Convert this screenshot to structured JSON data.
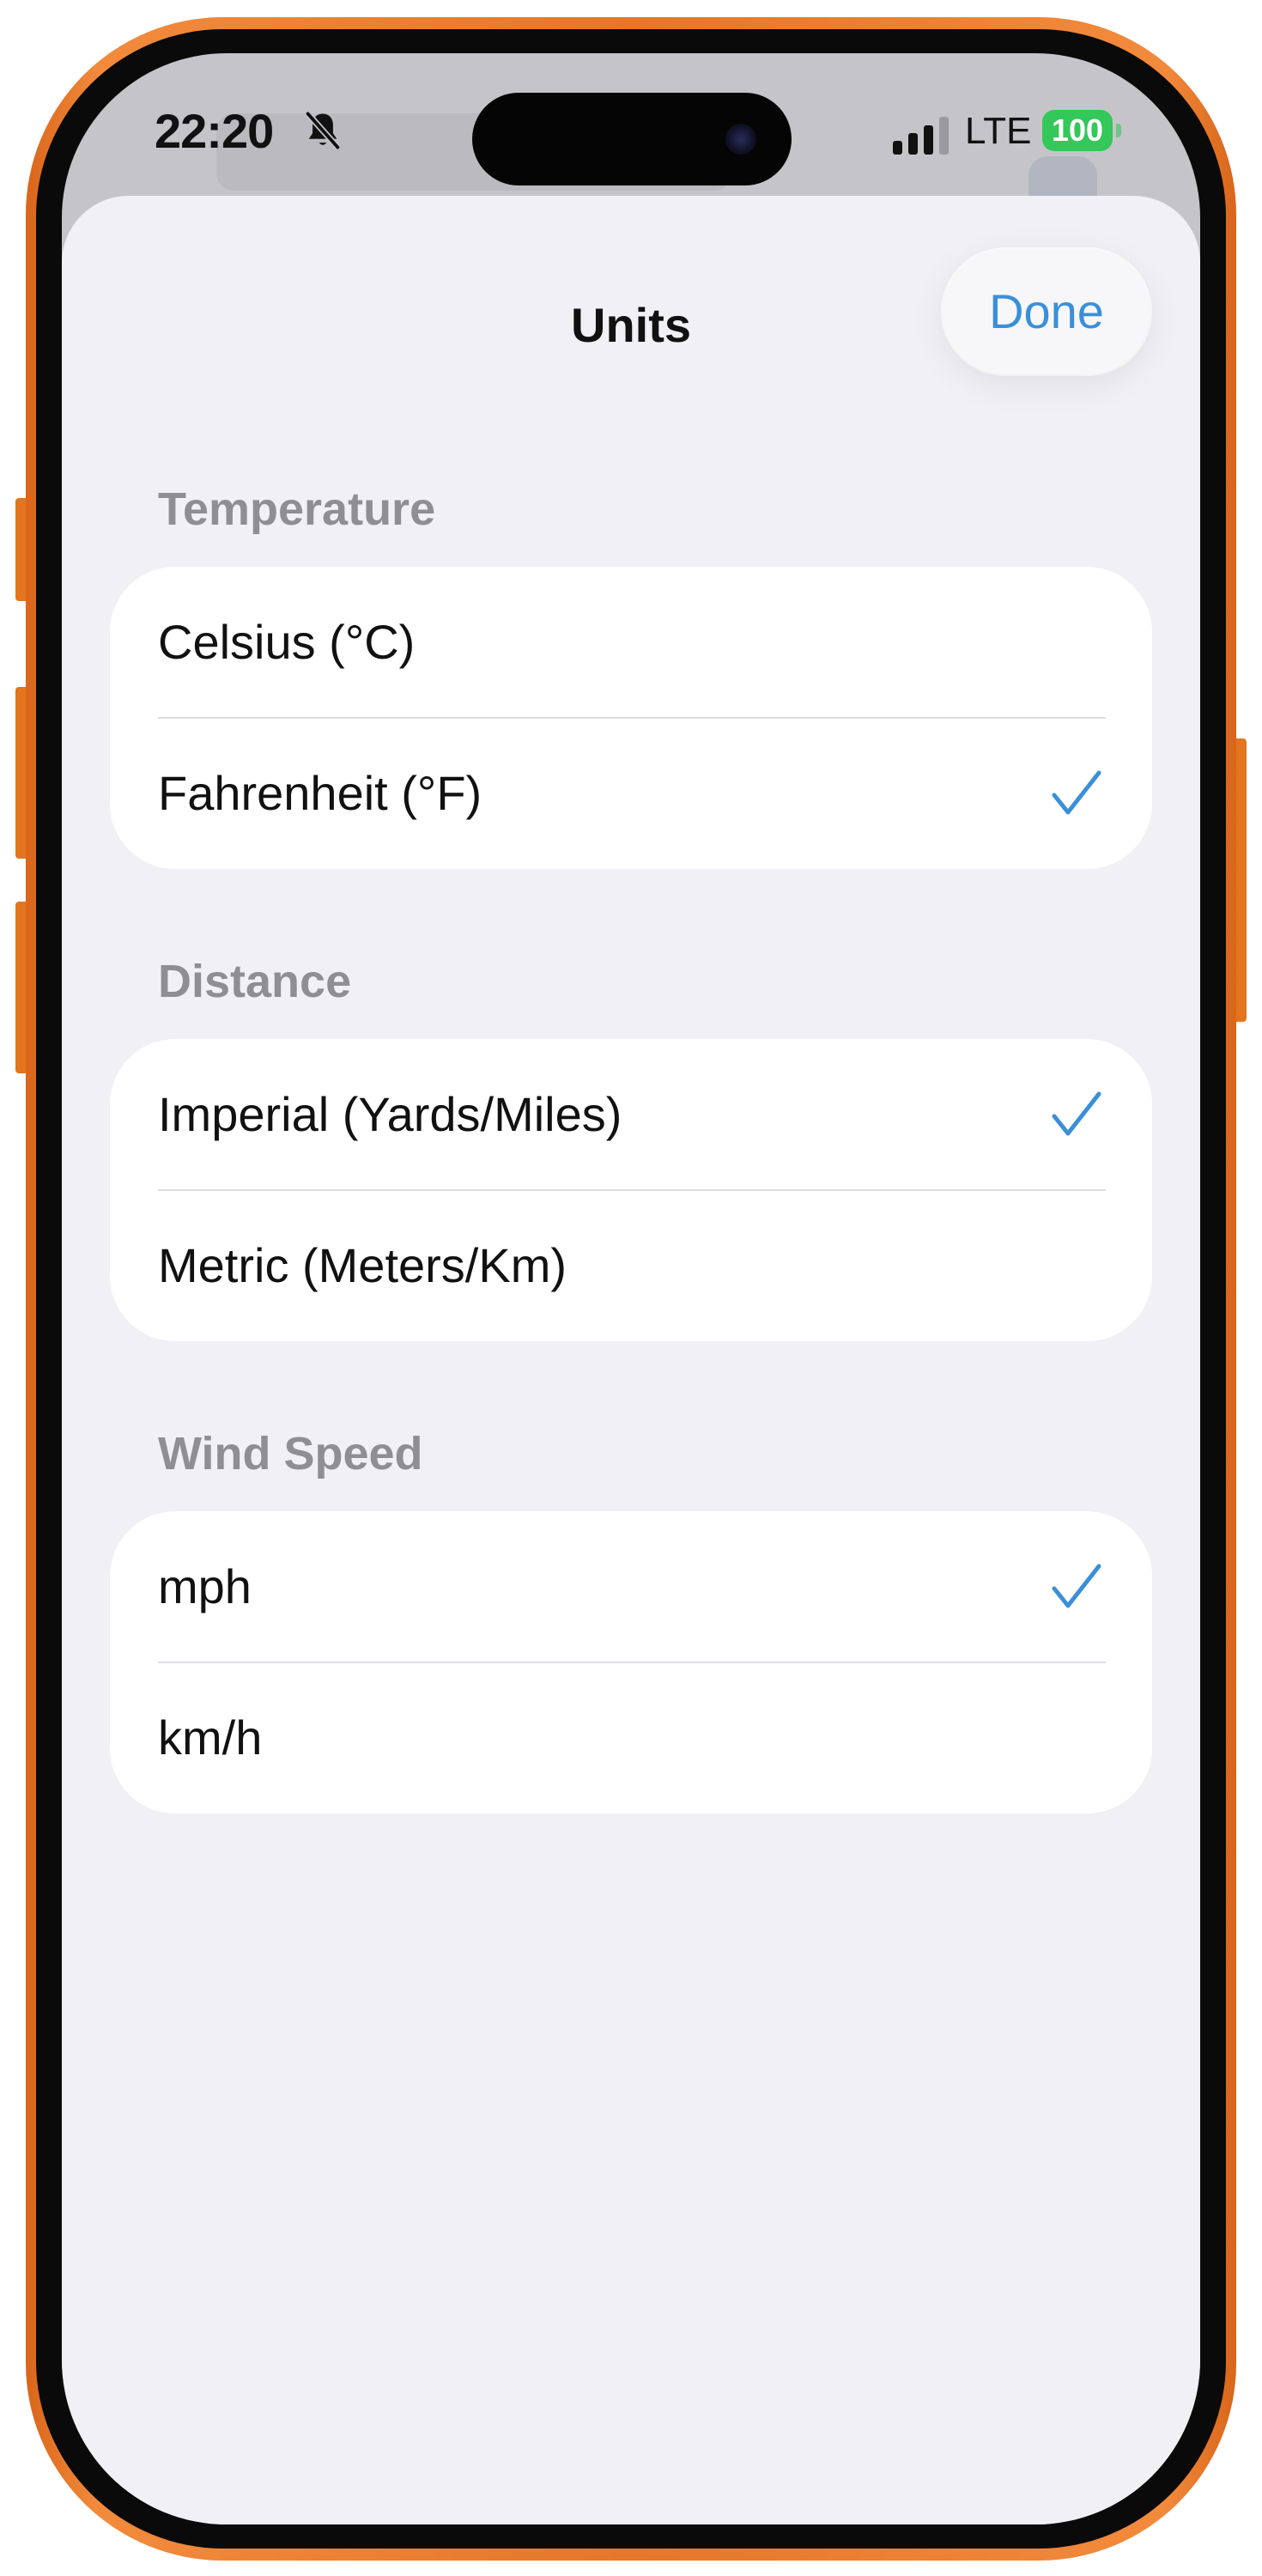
{
  "status_bar": {
    "time": "22:20",
    "network": "LTE",
    "battery": "100",
    "battery_color": "#34c759"
  },
  "sheet": {
    "title": "Units",
    "done_label": "Done",
    "accent_color": "#3a8fd9"
  },
  "sections": [
    {
      "label": "Temperature",
      "options": [
        {
          "label": "Celsius (°C)",
          "selected": false
        },
        {
          "label": "Fahrenheit (°F)",
          "selected": true
        }
      ]
    },
    {
      "label": "Distance",
      "options": [
        {
          "label": "Imperial (Yards/Miles)",
          "selected": true
        },
        {
          "label": "Metric (Meters/Km)",
          "selected": false
        }
      ]
    },
    {
      "label": "Wind Speed",
      "options": [
        {
          "label": "mph",
          "selected": true
        },
        {
          "label": "km/h",
          "selected": false
        }
      ]
    }
  ],
  "icons": {
    "silent": "bell-slash-icon",
    "signal": "cellular-signal-icon",
    "check": "checkmark-icon"
  }
}
